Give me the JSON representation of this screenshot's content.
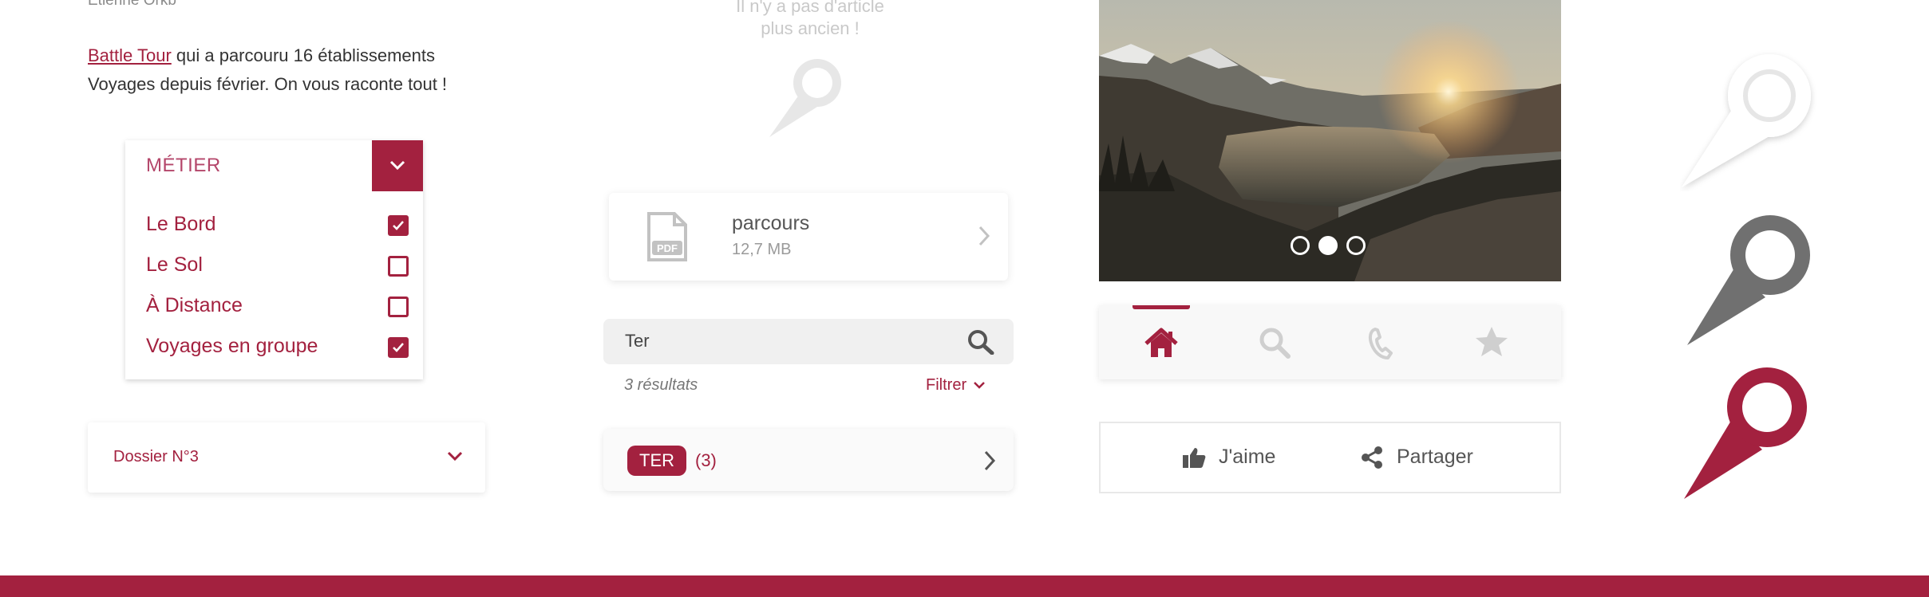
{
  "article": {
    "author": "Etienne Orkb",
    "link_text": "Battle Tour",
    "text_after_link": " qui a parcouru 16 établissements",
    "text_line2": "Voyages depuis février. On vous raconte tout !"
  },
  "metier_dropdown": {
    "label": "MÉTIER",
    "options": [
      {
        "label": "Le Bord",
        "checked": true
      },
      {
        "label": "Le Sol",
        "checked": false
      },
      {
        "label": "À Distance",
        "checked": false
      },
      {
        "label": "Voyages en groupe",
        "checked": true
      }
    ]
  },
  "dossier": {
    "label": "Dossier N°3"
  },
  "empty_state": {
    "line1": "Il n'y a pas d'article",
    "line2": "plus ancien !"
  },
  "file": {
    "name": "parcours",
    "size": "12,7 MB",
    "icon": "pdf-file-icon"
  },
  "search": {
    "value": "Ter",
    "results": "3 résultats",
    "filter_label": "Filtrer"
  },
  "tag_row": {
    "tag": "TER",
    "count": "(3)"
  },
  "carousel": {
    "slides": 3,
    "active_index": 1
  },
  "tabbar": {
    "tabs": [
      "home-icon",
      "search-icon",
      "phone-icon",
      "star-icon"
    ],
    "active": 0
  },
  "actions": {
    "like": "J'aime",
    "share": "Partager"
  },
  "colors": {
    "accent": "#a3213f",
    "light_gray": "#e0e0e0",
    "mid_gray": "#707070"
  }
}
